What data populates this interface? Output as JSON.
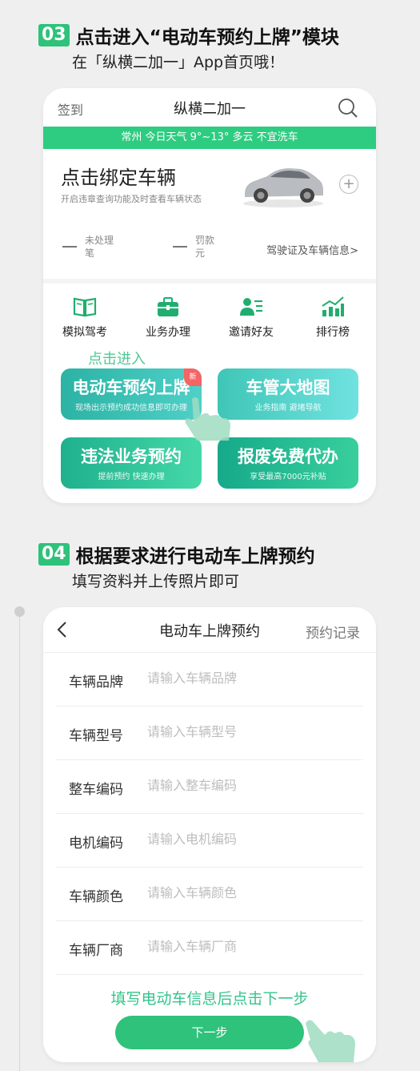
{
  "step3": {
    "num": "03",
    "title": "点击进入“电动车预约上牌”模块",
    "subtitle": "在「纵横二加一」App首页哦！"
  },
  "app": {
    "checkin": "签到",
    "title": "纵横二加一",
    "weather": "常州  今日天气 9°~13° 多云  不宜洗车",
    "bind_title": "点击绑定车辆",
    "bind_sub": "开启违章查询功能及时查看车辆状态",
    "plus": "+",
    "stat1_label": "未处理",
    "stat1_unit": "笔",
    "stat2_label": "罚款",
    "stat2_unit": "元",
    "license_link": "驾驶证及车辆信息>",
    "icons": [
      {
        "label": "模拟驾考",
        "icon": "book-icon"
      },
      {
        "label": "业务办理",
        "icon": "briefcase-icon"
      },
      {
        "label": "邀请好友",
        "icon": "user-card-icon"
      },
      {
        "label": "排行榜",
        "icon": "chart-icon"
      }
    ],
    "tap_hint": "点击进入",
    "tiles": [
      {
        "title": "电动车预约上牌",
        "sub": "现场出示预约成功信息即可办理",
        "badge": "新"
      },
      {
        "title": "车管大地图",
        "sub": "业务指南 避堵导航"
      },
      {
        "title": "违法业务预约",
        "sub": "提前预约 快速办理"
      },
      {
        "title": "报废免费代办",
        "sub": "享受最高7000元补贴"
      }
    ]
  },
  "step4": {
    "num": "04",
    "title": "根据要求进行电动车上牌预约",
    "subtitle": "填写资料并上传照片即可"
  },
  "form": {
    "title": "电动车上牌预约",
    "record": "预约记录",
    "fields": [
      {
        "label": "车辆品牌",
        "placeholder": "请输入车辆品牌",
        "value": ""
      },
      {
        "label": "车辆型号",
        "placeholder": "请输入车辆型号",
        "value": ""
      },
      {
        "label": "整车编码",
        "placeholder": "请输入整车编码",
        "value": ""
      },
      {
        "label": "电机编码",
        "placeholder": "请输入电机编码",
        "value": ""
      },
      {
        "label": "车辆颜色",
        "placeholder": "请输入车辆颜色",
        "value": ""
      },
      {
        "label": "车辆厂商",
        "placeholder": "请输入车辆厂商",
        "value": ""
      }
    ],
    "hint": "填写电动车信息后点击下一步",
    "next": "下一步"
  },
  "colors": {
    "accent": "#2ec27a",
    "weather_bar": "#2ecc80",
    "hint": "#4fc893"
  }
}
